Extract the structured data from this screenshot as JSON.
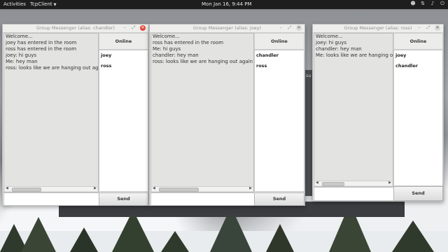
{
  "topbar": {
    "activities": "Activities",
    "app_name": "TcpClient",
    "clock": "Mon Jan 16,  9:44 PM"
  },
  "windows": [
    {
      "title": "Group Messenger (alias: chandler)",
      "messages": [
        "Welcome...",
        "joey has entered in the room",
        "ross has entered in the room",
        "joey: hi guys",
        "Me: hey man",
        "ross: looks like we are hanging out again"
      ],
      "online_label": "Online",
      "users": [
        "joey",
        "ross"
      ],
      "send_label": "Send"
    },
    {
      "title": "Group Messenger (alias: joey)",
      "messages": [
        "Welcome...",
        "ross has entered in the room",
        "Me: hi guys",
        "chandler: hey man",
        "ross: looks like we are hanging out again"
      ],
      "online_label": "Online",
      "users": [
        "chandler",
        "ross"
      ],
      "send_label": "Send"
    },
    {
      "title": "Group Messenger (alias: ross)",
      "messages": [
        "Welcome...",
        "joey: hi guys",
        "chandler: hey man",
        "Me: looks like we are hanging ou"
      ],
      "online_label": "Online",
      "users": [
        "joey",
        "chandler"
      ],
      "send_label": "Send"
    }
  ],
  "background_fragment": "su"
}
